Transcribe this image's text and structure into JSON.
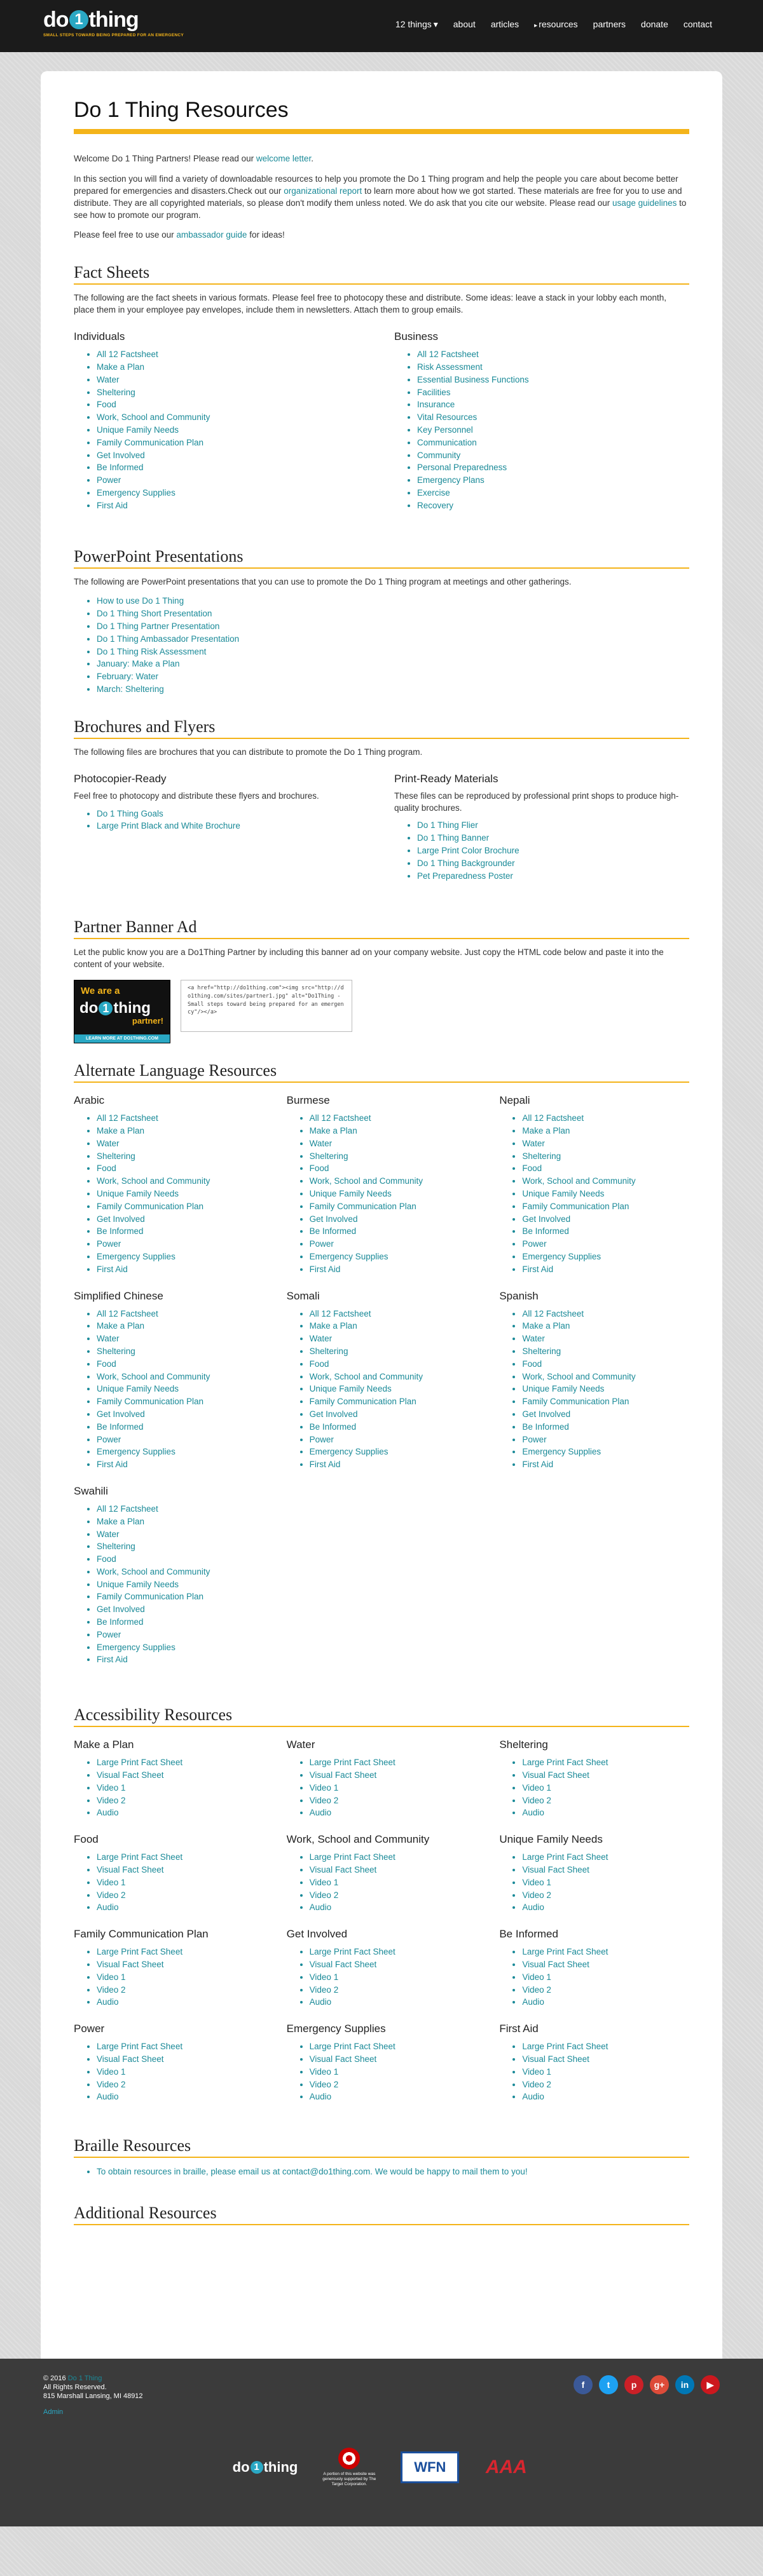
{
  "header": {
    "logo_text_a": "do",
    "logo_text_one": "1",
    "logo_text_b": "thing",
    "logo_tagline": "SMALL STEPS TOWARD BEING PREPARED FOR AN EMERGENCY",
    "nav": [
      {
        "label": "12 things",
        "dropdown": "▾"
      },
      {
        "label": "about"
      },
      {
        "label": "articles"
      },
      {
        "label": "resources",
        "active": true
      },
      {
        "label": "partners"
      },
      {
        "label": "donate"
      },
      {
        "label": "contact"
      }
    ]
  },
  "page": {
    "title": "Do 1 Thing Resources",
    "intro_p1_a": "Welcome Do 1 Thing Partners! Please read our ",
    "intro_p1_link": "welcome letter",
    "intro_p1_b": ".",
    "intro_p2_a": "In this section you will find a variety of downloadable resources to help you promote the Do 1 Thing program and help the people you care about become better prepared for emergencies and disasters.Check out our ",
    "intro_p2_link1": "organizational report",
    "intro_p2_b": " to learn more about how we got started. These materials are free for you to use and distribute. They are all copyrighted materials, so please don't modify them unless noted. We do ask that you cite our website. Please read our ",
    "intro_p2_link2": "usage guidelines",
    "intro_p2_c": " to see how to promote our program.",
    "intro_p3_a": "Please feel free to use our ",
    "intro_p3_link": "ambassador guide",
    "intro_p3_b": " for ideas!"
  },
  "fact_sheets": {
    "title": "Fact Sheets",
    "desc": "The following are the fact sheets in various formats. Please feel free to photocopy these and distribute. Some ideas: leave a stack in your lobby each month, place them in your employee pay envelopes, include them in newsletters. Attach them to group emails.",
    "individuals_title": "Individuals",
    "individuals": [
      "All 12 Factsheet",
      "Make a Plan",
      "Water",
      "Sheltering",
      "Food",
      "Work, School and Community",
      "Unique Family Needs",
      "Family Communication Plan",
      "Get Involved",
      "Be Informed",
      "Power",
      "Emergency Supplies",
      "First Aid"
    ],
    "business_title": "Business",
    "business": [
      "All 12 Factsheet",
      "Risk Assessment",
      "Essential Business Functions",
      "Facilities",
      "Insurance",
      "Vital Resources",
      "Key Personnel",
      "Communication",
      "Community",
      "Personal Preparedness",
      "Emergency Plans",
      "Exercise",
      "Recovery"
    ]
  },
  "powerpoint": {
    "title": "PowerPoint Presentations",
    "desc": "The following are PowerPoint presentations that you can use to promote the Do 1 Thing program at meetings and other gatherings.",
    "items": [
      "How to use Do 1 Thing",
      "Do 1 Thing Short Presentation",
      "Do 1 Thing Partner Presentation",
      "Do 1 Thing Ambassador Presentation",
      "Do 1 Thing Risk Assessment",
      "January: Make a Plan",
      "February: Water",
      "March: Sheltering"
    ]
  },
  "brochures": {
    "title": "Brochures and Flyers",
    "desc": "The following files are brochures that you can distribute to promote the Do 1 Thing program.",
    "photocopier_title": "Photocopier-Ready",
    "photocopier_desc": "Feel free to photocopy and distribute these flyers and brochures.",
    "photocopier": [
      "Do 1 Thing Goals",
      "Large Print Black and White Brochure"
    ],
    "print_title": "Print-Ready Materials",
    "print_desc": "These files can be reproduced by professional print shops to produce high-quality brochures.",
    "print": [
      "Do 1 Thing Flier",
      "Do 1 Thing Banner",
      "Large Print Color Brochure",
      "Do 1 Thing Backgrounder",
      "Pet Preparedness Poster"
    ]
  },
  "banner_ad": {
    "title": "Partner Banner Ad",
    "desc": "Let the public know you are a Do1Thing Partner by including this banner ad on your company website. Just copy the HTML code below and paste it into the content of your website.",
    "banner_we": "We are a",
    "banner_logo_a": "do",
    "banner_logo_one": "1",
    "banner_logo_b": "thing",
    "banner_partner": "partner!",
    "banner_learn": "LEARN MORE AT DO1THING.COM",
    "code": "<a href=\"http://do1thing.com\"><img src=\"http://do1thing.com/sites/partner1.jpg\" alt=\"Do1Thing - Small steps toward being prepared for an emergency\"/></a>"
  },
  "languages": {
    "title": "Alternate Language Resources",
    "groups": [
      {
        "name": "Arabic",
        "items": [
          "All 12 Factsheet",
          "Make a Plan",
          "Water",
          "Sheltering",
          "Food",
          "Work, School and Community",
          "Unique Family Needs",
          "Family Communication Plan",
          "Get Involved",
          "Be Informed",
          "Power",
          "Emergency Supplies",
          "First Aid"
        ]
      },
      {
        "name": "Burmese",
        "items": [
          "All 12 Factsheet",
          "Make a Plan",
          "Water",
          "Sheltering",
          "Food",
          "Work, School and Community",
          "Unique Family Needs",
          "Family Communication Plan",
          "Get Involved",
          "Be Informed",
          "Power",
          "Emergency Supplies",
          "First Aid"
        ]
      },
      {
        "name": "Nepali",
        "items": [
          "All 12 Factsheet",
          "Make a Plan",
          "Water",
          "Sheltering",
          "Food",
          "Work, School and Community",
          "Unique Family Needs",
          "Family Communication Plan",
          "Get Involved",
          "Be Informed",
          "Power",
          "Emergency Supplies",
          "First Aid"
        ]
      },
      {
        "name": "Simplified Chinese",
        "items": [
          "All 12 Factsheet",
          "Make a Plan",
          "Water",
          "Sheltering",
          "Food",
          "Work, School and Community",
          "Unique Family Needs",
          "Family Communication Plan",
          "Get Involved",
          "Be Informed",
          "Power",
          "Emergency Supplies",
          "First Aid"
        ]
      },
      {
        "name": "Somali",
        "items": [
          "All 12 Factsheet",
          "Make a Plan",
          "Water",
          "Sheltering",
          "Food",
          "Work, School and Community",
          "Unique Family Needs",
          "Family Communication Plan",
          "Get Involved",
          "Be Informed",
          "Power",
          "Emergency Supplies",
          "First Aid"
        ]
      },
      {
        "name": "Spanish",
        "items": [
          "All 12 Factsheet",
          "Make a Plan",
          "Water",
          "Sheltering",
          "Food",
          "Work, School and Community",
          "Unique Family Needs",
          "Family Communication Plan",
          "Get Involved",
          "Be Informed",
          "Power",
          "Emergency Supplies",
          "First Aid"
        ]
      },
      {
        "name": "Swahili",
        "items": [
          "All 12 Factsheet",
          "Make a Plan",
          "Water",
          "Sheltering",
          "Food",
          "Work, School and Community",
          "Unique Family Needs",
          "Family Communication Plan",
          "Get Involved",
          "Be Informed",
          "Power",
          "Emergency Supplies",
          "First Aid"
        ]
      }
    ]
  },
  "accessibility": {
    "title": "Accessibility Resources",
    "groups": [
      {
        "name": "Make a Plan",
        "items": [
          "Large Print Fact Sheet",
          "Visual Fact Sheet",
          "Video 1",
          "Video 2",
          "Audio"
        ]
      },
      {
        "name": "Water",
        "items": [
          "Large Print Fact Sheet",
          "Visual Fact Sheet",
          "Video 1",
          "Video 2",
          "Audio"
        ]
      },
      {
        "name": "Sheltering",
        "items": [
          "Large Print Fact Sheet",
          "Visual Fact Sheet",
          "Video 1",
          "Video 2",
          "Audio"
        ]
      },
      {
        "name": "Food",
        "items": [
          "Large Print Fact Sheet",
          "Visual Fact Sheet",
          "Video 1",
          "Video 2",
          "Audio"
        ]
      },
      {
        "name": "Work, School and Community",
        "items": [
          "Large Print Fact Sheet",
          "Visual Fact Sheet",
          "Video 1",
          "Video 2",
          "Audio"
        ]
      },
      {
        "name": "Unique Family Needs",
        "items": [
          "Large Print Fact Sheet",
          "Visual Fact Sheet",
          "Video 1",
          "Video 2",
          "Audio"
        ]
      },
      {
        "name": "Family Communication Plan",
        "items": [
          "Large Print Fact Sheet",
          "Visual Fact Sheet",
          "Video 1",
          "Video 2",
          "Audio"
        ]
      },
      {
        "name": "Get Involved",
        "items": [
          "Large Print Fact Sheet",
          "Visual Fact Sheet",
          "Video 1",
          "Video 2",
          "Audio"
        ]
      },
      {
        "name": "Be Informed",
        "items": [
          "Large Print Fact Sheet",
          "Visual Fact Sheet",
          "Video 1",
          "Video 2",
          "Audio"
        ]
      },
      {
        "name": "Power",
        "items": [
          "Large Print Fact Sheet",
          "Visual Fact Sheet",
          "Video 1",
          "Video 2",
          "Audio"
        ]
      },
      {
        "name": "Emergency Supplies",
        "items": [
          "Large Print Fact Sheet",
          "Visual Fact Sheet",
          "Video 1",
          "Video 2",
          "Audio"
        ]
      },
      {
        "name": "First Aid",
        "items": [
          "Large Print Fact Sheet",
          "Visual Fact Sheet",
          "Video 1",
          "Video 2",
          "Audio"
        ]
      }
    ]
  },
  "braille": {
    "title": "Braille Resources",
    "text_a": "To obtain resources in braille, please email us at ",
    "email": "contact@do1thing.com",
    "text_b": ". We would be happy to mail them to you!"
  },
  "additional": {
    "title": "Additional Resources"
  },
  "footer": {
    "copyright_a": "© 2016 ",
    "copyright_link": "Do 1 Thing",
    "rights": "All Rights Reserved.",
    "address": "815 Marshall Lansing, MI 48912",
    "admin": "Admin",
    "social": [
      {
        "icon": "facebook-icon",
        "glyph": "f",
        "color": "#3b5998"
      },
      {
        "icon": "twitter-icon",
        "glyph": "t",
        "color": "#1da1f2"
      },
      {
        "icon": "pinterest-icon",
        "glyph": "p",
        "color": "#cb2027"
      },
      {
        "icon": "google-plus-icon",
        "glyph": "g+",
        "color": "#dd4b39"
      },
      {
        "icon": "linkedin-icon",
        "glyph": "in",
        "color": "#0077b5"
      },
      {
        "icon": "youtube-icon",
        "glyph": "▶",
        "color": "#cc181e"
      }
    ],
    "sponsor_logo_a": "do",
    "sponsor_logo_one": "1",
    "sponsor_logo_b": "thing",
    "target_text": "A portion of this website was generously supported by The Target Corporation.",
    "wfn_text": "WFN",
    "aaa_text": "AAA"
  },
  "colors": {
    "accent": "#f4b41a",
    "link": "#1a8a98",
    "brand_blue": "#2aa8c4"
  }
}
